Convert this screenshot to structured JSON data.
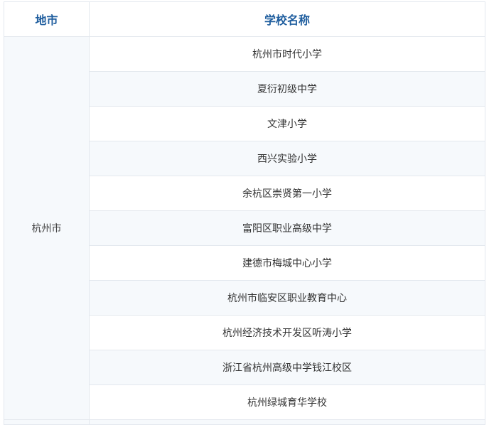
{
  "table": {
    "headers": {
      "city": "地市",
      "school": "学校名称"
    },
    "group": {
      "city": "杭州市",
      "schools": [
        "杭州市时代小学",
        "夏衍初级中学",
        "文津小学",
        "西兴实验小学",
        "余杭区崇贤第一小学",
        "富阳区职业高级中学",
        "建德市梅城中心小学",
        "杭州市临安区职业教育中心",
        "杭州经济技术开发区听涛小学",
        "浙江省杭州高级中学钱江校区",
        "杭州绿城育华学校"
      ]
    }
  }
}
